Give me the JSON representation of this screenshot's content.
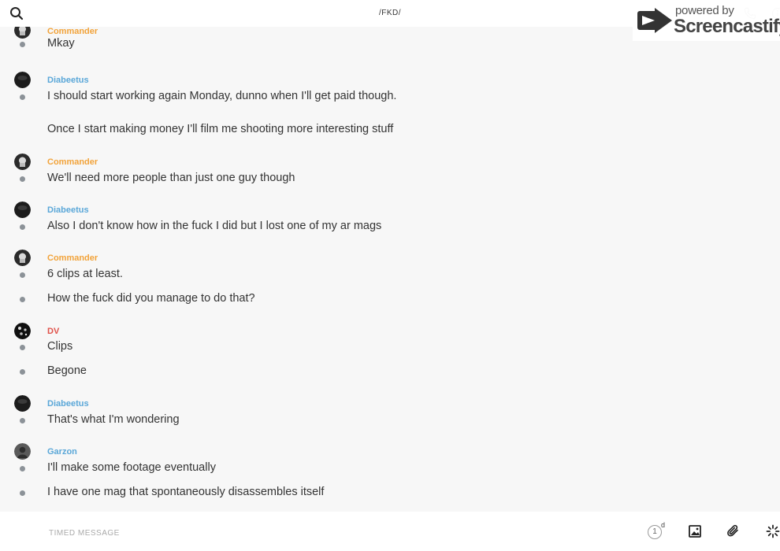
{
  "header": {
    "title": "/FKD/"
  },
  "watermark": {
    "powered_by": "powered by",
    "brand": "Screencastify"
  },
  "messages": [
    {
      "sender": "Commander",
      "texts": [
        "Mkay"
      ]
    },
    {
      "sender": "Diabeetus",
      "texts": [
        "I should start working again Monday, dunno when I'll get paid though.",
        "Once I start making money I'll film me shooting more interesting stuff"
      ]
    },
    {
      "sender": "Commander",
      "texts": [
        "We'll need more people than just one guy though"
      ]
    },
    {
      "sender": "Diabeetus",
      "texts": [
        "Also I don't know how in the fuck I did but I lost one of my ar mags"
      ]
    },
    {
      "sender": "Commander",
      "texts": [
        "6 clips at least.",
        "How the fuck did you manage to do that?"
      ]
    },
    {
      "sender": "DV",
      "texts": [
        "Clips",
        "Begone"
      ]
    },
    {
      "sender": "Diabeetus",
      "texts": [
        "That's what I'm wondering"
      ]
    },
    {
      "sender": "Garzon",
      "texts": [
        "I'll make some footage eventually",
        "I have one mag that spontaneously disassembles itself"
      ]
    }
  ],
  "composer": {
    "placeholder": "TIMED MESSAGE",
    "timer_value": "1",
    "timer_unit": "d"
  },
  "colors": {
    "commander": "#f2a33a",
    "diabeetus": "#5aa7d8",
    "dv": "#e0524a",
    "garzon": "#5aa7d8"
  },
  "icons": {
    "search": "search-icon",
    "phone": "phone-icon",
    "info": "info-icon",
    "image": "image-icon",
    "attach": "paperclip-icon",
    "more": "loading-spinner-icon"
  }
}
